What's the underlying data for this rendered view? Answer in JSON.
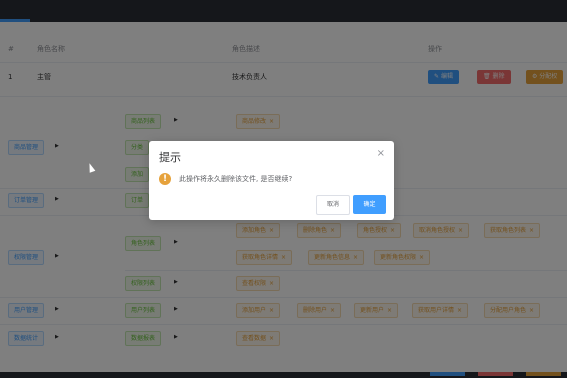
{
  "table": {
    "headers": {
      "index": "#",
      "role_name": "角色名称",
      "role_desc": "角色描述",
      "operations": "操作"
    },
    "row": {
      "index": "1",
      "role_name": "主管",
      "role_desc": "技术负责人",
      "edit_label": "编辑",
      "delete_label": "删除",
      "assign_label": "分配权"
    }
  },
  "permissions": {
    "level1": [
      "商品管理",
      "订单管理",
      "权限管理",
      "用户管理",
      "数据统计"
    ],
    "level2": [
      "商品列表",
      "分类",
      "添加",
      "订单",
      "角色列表",
      "权限列表",
      "用户列表",
      "数据报表"
    ],
    "level3": [
      "商品修改",
      "添加角色",
      "删除角色",
      "角色授权",
      "取消角色授权",
      "获取角色列表",
      "获取角色详情",
      "更新角色信息",
      "更新角色权限",
      "查看权限",
      "添加用户",
      "删除用户",
      "更新用户",
      "获取用户详情",
      "分配用户角色",
      "查看数据"
    ]
  },
  "dialog": {
    "title": "提示",
    "message": "此操作将永久删除该文件, 是否继续?",
    "cancel_label": "取消",
    "confirm_label": "确定",
    "warn_symbol": "!",
    "close_symbol": "×"
  },
  "icons": {
    "close": "close-icon",
    "warning": "warning-icon"
  },
  "colors": {
    "primary": "#409eff",
    "danger": "#f56c6c",
    "warning": "#e6a23c",
    "success": "#67c23a"
  }
}
